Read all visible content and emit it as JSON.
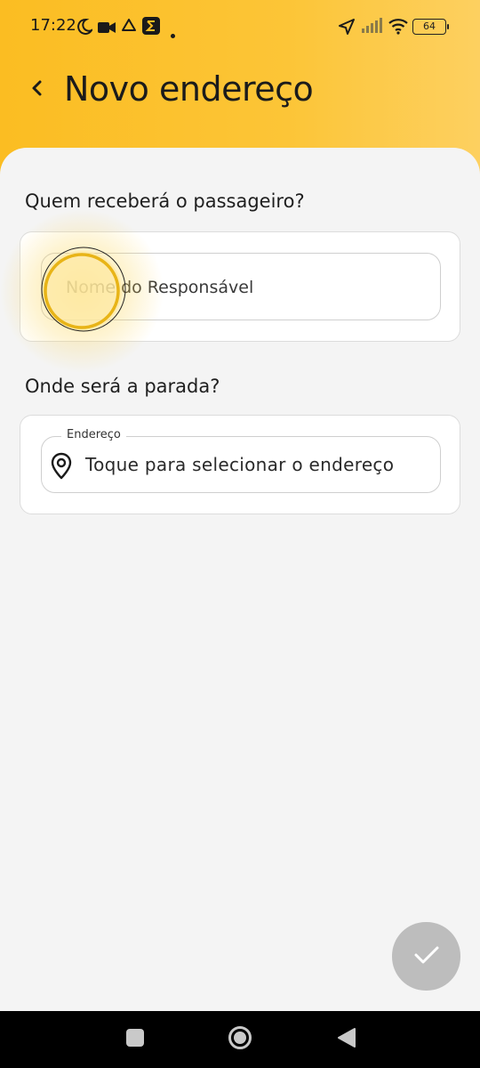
{
  "status_bar": {
    "time": "17:22",
    "battery": "64"
  },
  "header": {
    "title": "Novo endereço"
  },
  "recipient_section": {
    "title": "Quem receberá o passageiro?",
    "field_placeholder": "Nome do Responsável"
  },
  "stop_section": {
    "title": "Onde será a parada?",
    "field_label": "Endereço",
    "field_placeholder": "Toque para selecionar o endereço"
  },
  "colors": {
    "accent": "#fbbd22",
    "fab_disabled": "#bdbdbd",
    "background": "#f4f4f4"
  },
  "icons": {
    "back": "chevron-left-icon",
    "location": "location-pin-icon",
    "confirm": "check-icon",
    "nav_recents": "square-icon",
    "nav_home": "circle-icon",
    "nav_back": "triangle-back-icon"
  }
}
